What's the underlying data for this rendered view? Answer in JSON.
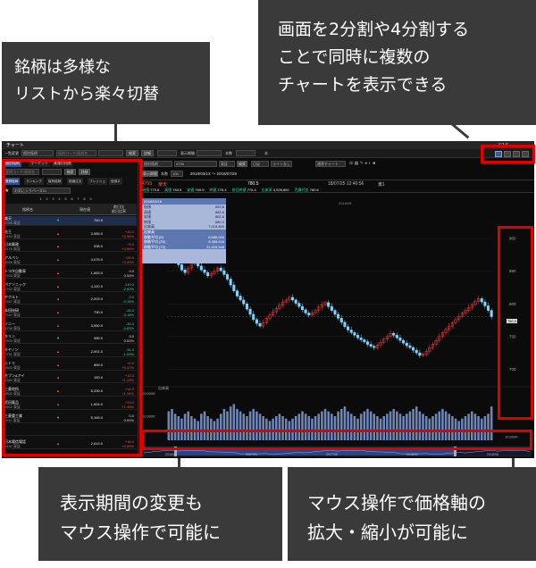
{
  "callouts": {
    "lists": [
      "銘柄は多様な",
      "リストから楽々切替"
    ],
    "split": [
      "画面を2分割や4分割する",
      "ことで同時に複数の",
      "チャートを表示できる"
    ],
    "period": [
      "表示期間の変更も",
      "マウス操作で可能に"
    ],
    "axis": [
      "マウス操作で価格軸の",
      "拡大・縮小が可能に"
    ]
  },
  "window": {
    "title": "チャート",
    "top_right_label": "マスタ"
  },
  "toolbar": {
    "view_change": "一覧変更",
    "stock_field": "個別銘柄",
    "code_placeholder": "銘柄コード/銘柄名",
    "search_btn": "検索",
    "detail_btn": "詳細",
    "period_label": "表示期間",
    "count_label": "本数",
    "unit": "本"
  },
  "list_panel": {
    "top_tabs": [
      "個別銘柄",
      "マーケット",
      "業種別指数"
    ],
    "search_placeholder": "銘柄コード/銘柄名",
    "search_btn": "検索",
    "detail_btn": "詳細",
    "sub_tabs": [
      "登録銘柄",
      "ランキング",
      "保有銘柄",
      "指値注文",
      "フレッシュ",
      "信用ネ"
    ],
    "list_select": "お気に入りベース01",
    "pages": [
      "1",
      "2",
      "3",
      "4",
      "5",
      "6",
      "7",
      "8",
      "9"
    ],
    "col_name": "銘柄名",
    "col_price": "現在値",
    "col_change": "前日比",
    "col_change_pct": "前日比率",
    "rows": [
      {
        "name": "楽天",
        "code": "4755 東証",
        "mark": "▼",
        "price": "780.5",
        "ch1": "",
        "ch2": "",
        "dir": "dn"
      },
      {
        "name": "花王",
        "code": "4452 東証",
        "mark": "▲",
        "price": "3,585.0",
        "ch1": "+20.0",
        "ch2": "+0.56%",
        "dir": "up"
      },
      {
        "name": "日本郵政",
        "code": "6178 東証",
        "mark": "▲",
        "price": "538.0",
        "ch1": "+3.0",
        "ch2": "+0.56%",
        "dir": "up"
      },
      {
        "name": "アルペン",
        "code": "3028 東証",
        "mark": "▲",
        "price": "4,075.0",
        "ch1": "+20.0",
        "ch2": "+0.49%",
        "dir": "up"
      },
      {
        "name": "トヨタ自動車",
        "code": "7203 東証",
        "mark": "▲",
        "price": "1,663.0",
        "ch1": "0.0",
        "ch2": "0.00%",
        "dir": "flat"
      },
      {
        "name": "パナソニック",
        "code": "6752 東証",
        "mark": "▲",
        "price": "4,120.0",
        "ch1": "-110.0",
        "ch2": "-2.60%",
        "dir": "dn"
      },
      {
        "name": "ヤクルト",
        "code": "2267 東証",
        "mark": "▲",
        "price": "2,003.0",
        "ch1": "-3.0",
        "ch2": "-0.15%",
        "dir": "dn"
      },
      {
        "name": "本田技研",
        "code": "7267 東証",
        "mark": "▲",
        "price": "790.0",
        "ch1": "-26.0",
        "ch2": "-3.19%",
        "dir": "dn"
      },
      {
        "name": "ソニー",
        "code": "6758 東証",
        "mark": "▲",
        "price": "3,950.0",
        "ch1": "-33.0",
        "ch2": "-0.83%",
        "dir": "dn"
      },
      {
        "name": "キリン",
        "code": "2503 東証",
        "mark": "▼",
        "price": "980.0",
        "ch1": "0.0",
        "ch2": "0.00%",
        "dir": "flat"
      },
      {
        "name": "キヤノン",
        "code": "7751 東証",
        "mark": "▲",
        "price": "2,001.0",
        "ch1": "-31.0",
        "ch2": "-1.53%",
        "dir": "dn"
      },
      {
        "name": "ニトリ",
        "code": "9843 東証",
        "mark": "▲",
        "price": "859.0",
        "ch1": "+4.0",
        "ch2": "+0.47%",
        "dir": "up"
      },
      {
        "name": "セブン&アイ",
        "code": "3382 東証",
        "mark": "▲",
        "price": "150.0",
        "ch1": "+13.0",
        "ch2": "+1.23%",
        "dir": "up"
      },
      {
        "name": "三菱地所",
        "code": "8802 東証",
        "mark": "▲",
        "price": "5,330.0",
        "ch1": "+14.0",
        "ch2": "+1.34%",
        "dir": "up"
      },
      {
        "name": "武田薬品",
        "code": "4502 東証",
        "mark": "▲",
        "price": "1,604.0",
        "ch1": "+23.0",
        "ch2": "+1.45%",
        "dir": "up"
      },
      {
        "name": "三菱重工業",
        "code": "7011 東証",
        "mark": "▼",
        "price": "5,169.0",
        "ch1": "0.0",
        "ch2": "0.00%",
        "dir": "flat"
      },
      {
        "name": "-",
        "code": "",
        "mark": "",
        "price": "",
        "ch1": "",
        "ch2": "",
        "dir": "flat"
      },
      {
        "name": "日本電信電話",
        "code": "9432 東証",
        "mark": "▲",
        "price": "2,613.0",
        "ch1": "+18.0",
        "ch2": "+0.69%",
        "dir": "up"
      }
    ]
  },
  "chart_panel": {
    "stock_field": "個別銘柄",
    "code": "4755",
    "market": "東証",
    "candle_select": "日足",
    "mode_select": "ラインなし",
    "chart_type": "通常チャート",
    "display_period_btn": "表示期間",
    "count_label": "本数",
    "count_value": "100",
    "date_range": "2018/03/13 ～ 2018/07/25",
    "header_code": "4755",
    "header_name": "楽天",
    "header_price": "780.5",
    "header_time": "18/07/25  12:40:56",
    "header_tag": "東1",
    "header_row2": [
      {
        "label": "始値",
        "value": "779.6"
      },
      {
        "label": "高値",
        "value": "783.5"
      },
      {
        "label": "安値",
        "value": "769.9"
      },
      {
        "label": "終値",
        "value": "776.4"
      },
      {
        "label": "前日終値",
        "value": "776.4"
      },
      {
        "label": "出来高",
        "value": "4,928,800"
      },
      {
        "label": "売買代金",
        "value": "780.6"
      }
    ],
    "info_box": {
      "date": "2018/03/16",
      "rows": [
        {
          "label": "始値",
          "value": "863.6"
        },
        {
          "label": "高値",
          "value": "883.6"
        },
        {
          "label": "安値",
          "value": "862.8"
        },
        {
          "label": "終値",
          "value": "880.3"
        },
        {
          "label": "出来高",
          "value": "7,015,800"
        },
        {
          "label": "出来高",
          "value": ""
        },
        {
          "label": "移動平均 [5]",
          "value": "8,586,920"
        },
        {
          "label": "移動平均 [25]",
          "value": "9,385,516"
        },
        {
          "label": "移動平均 [75]",
          "value": "11,425,948"
        }
      ]
    },
    "month_label": "2018/06",
    "volume_label": "出来高",
    "current_price_tag": "780.5"
  },
  "chart_data": {
    "type": "candlestick",
    "title": "",
    "xlabel": "",
    "ylabel": "",
    "ylim": [
      695,
      955
    ],
    "yticks": [
      700,
      750,
      800,
      850,
      900
    ],
    "ytick_labels": [
      "700",
      "750",
      "800",
      "850",
      "900"
    ],
    "close": [
      882,
      878,
      872,
      860,
      852,
      848,
      855,
      866,
      862,
      858,
      852,
      848,
      843,
      846,
      850,
      855,
      851,
      845,
      838,
      829,
      820,
      812,
      806,
      800,
      792,
      784,
      776,
      770,
      766,
      771,
      778,
      783,
      788,
      793,
      798,
      803,
      806,
      810,
      806,
      801,
      796,
      791,
      786,
      783,
      786,
      790,
      795,
      799,
      802,
      796,
      790,
      784,
      778,
      772,
      765,
      760,
      756,
      752,
      748,
      745,
      742,
      738,
      735,
      733,
      737,
      741,
      746,
      750,
      755,
      752,
      748,
      744,
      740,
      736,
      733,
      729,
      725,
      721,
      723,
      727,
      733,
      738,
      744,
      750,
      756,
      761,
      766,
      771,
      776,
      781,
      786,
      790,
      794,
      799,
      804,
      808,
      803,
      797,
      790,
      780.5
    ],
    "volume": [
      12,
      13,
      11,
      10,
      9,
      11,
      12,
      10,
      9,
      8,
      11,
      12,
      10,
      9,
      8,
      9,
      11,
      13,
      12,
      14,
      15,
      13,
      12,
      11,
      10,
      12,
      13,
      12,
      11,
      10,
      9,
      8,
      9,
      10,
      11,
      10,
      9,
      8,
      9,
      10,
      11,
      12,
      11,
      10,
      9,
      10,
      11,
      12,
      13,
      12,
      11,
      10,
      12,
      13,
      14,
      12,
      11,
      10,
      9,
      11,
      12,
      13,
      12,
      11,
      10,
      9,
      10,
      11,
      12,
      13,
      12,
      11,
      10,
      11,
      12,
      13,
      14,
      12,
      11,
      10,
      9,
      10,
      11,
      12,
      13,
      12,
      11,
      10,
      9,
      8,
      9,
      10,
      11,
      12,
      11,
      10,
      9,
      10,
      11,
      14
    ],
    "vol_ylim": [
      0,
      20
    ],
    "vol_ytick_labels": [
      "20,000K",
      "10,000K"
    ],
    "navigator_labels": [
      "2016/01",
      "2017/01",
      "2017/06",
      "2018/01",
      "2018/06"
    ]
  }
}
